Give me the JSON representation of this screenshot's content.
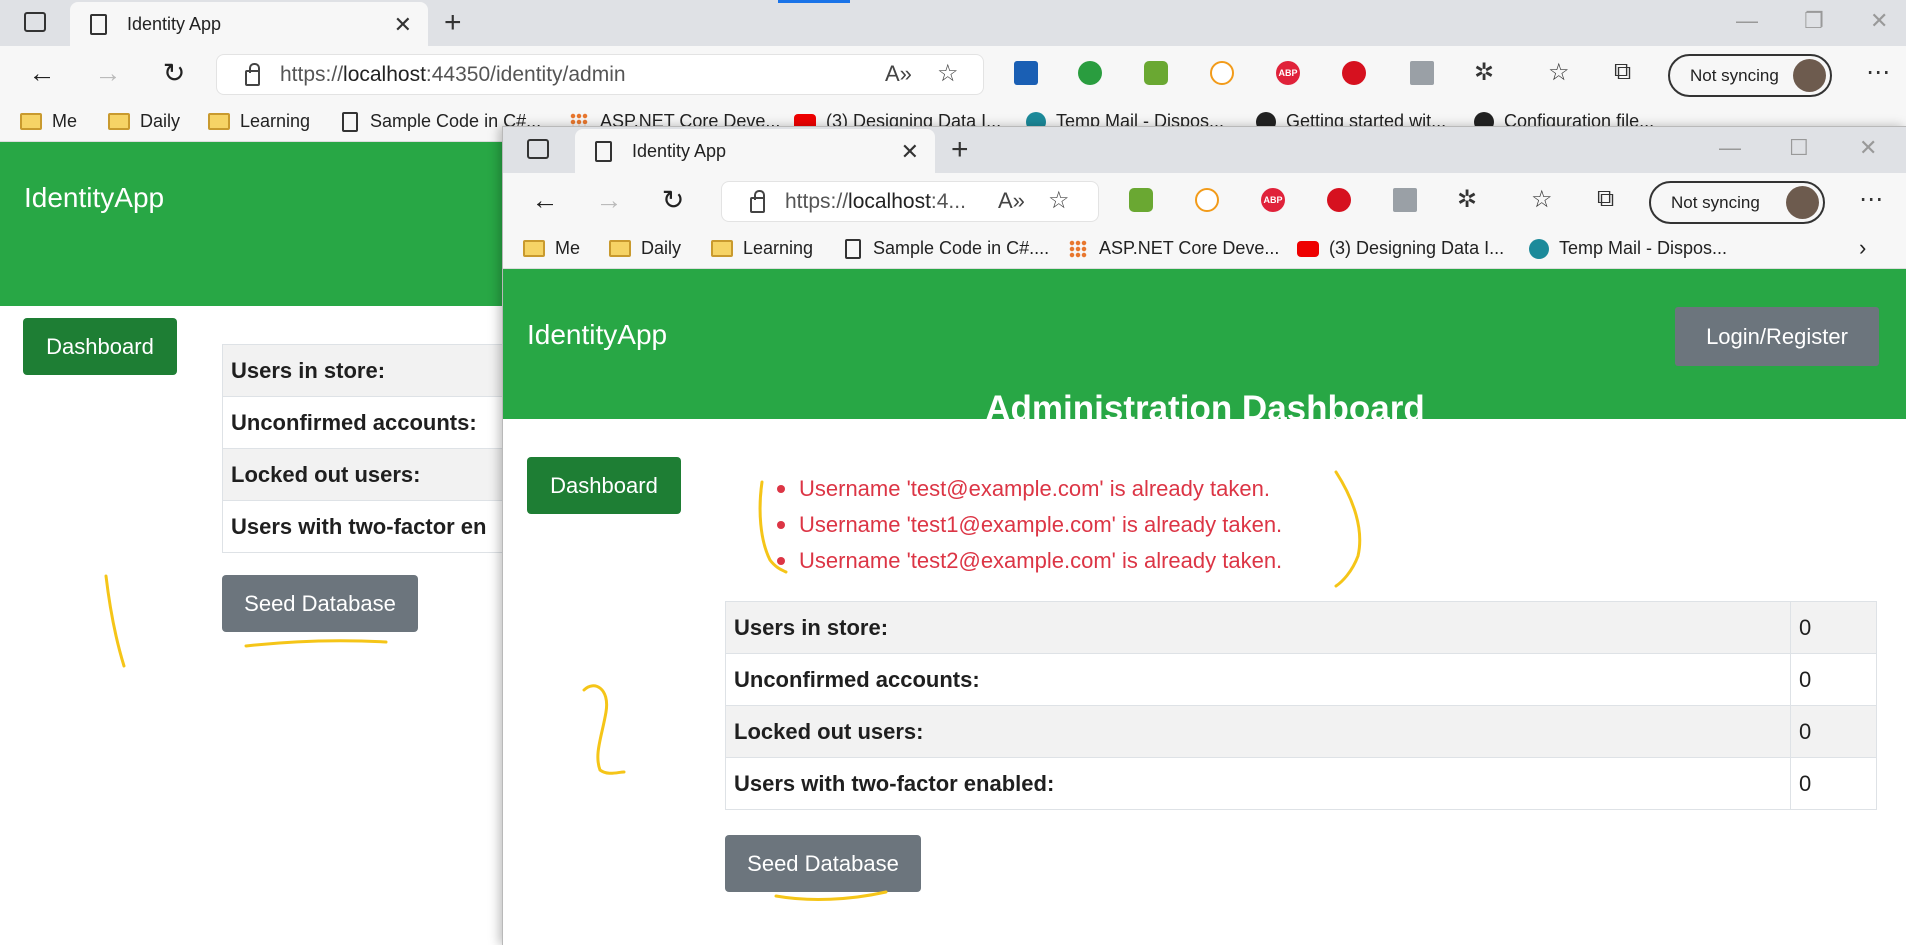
{
  "back_window": {
    "tab_title": "Identity App",
    "url_prefix": "https://",
    "url_host": "localhost",
    "url_rest": ":44350/identity/admin",
    "sync_label": "Not syncing",
    "bookmarks": [
      "Me",
      "Daily",
      "Learning",
      "Sample Code in C#...",
      "ASP.NET Core Deve...",
      "(3) Designing Data I...",
      "Temp Mail - Dispos...",
      "Getting started wit...",
      "Configuration file..."
    ],
    "brand": "IdentityApp",
    "dashboard_label": "Dashboard",
    "stats_labels": [
      "Users in store:",
      "Unconfirmed accounts:",
      "Locked out users:",
      "Users with two-factor en"
    ],
    "seed_label": "Seed Database"
  },
  "front_window": {
    "tab_title": "Identity App",
    "url_prefix": "https://",
    "url_host": "localhost",
    "url_rest": ":4...",
    "sync_label": "Not syncing",
    "bookmarks": [
      "Me",
      "Daily",
      "Learning",
      "Sample Code in C#....",
      "ASP.NET Core Deve...",
      "(3) Designing Data I...",
      "Temp Mail - Dispos..."
    ],
    "brand": "IdentityApp",
    "login_label": "Login/Register",
    "page_title": "Administration Dashboard",
    "dashboard_label": "Dashboard",
    "errors": [
      "Username 'test@example.com' is already taken.",
      "Username 'test1@example.com' is already taken.",
      "Username 'test2@example.com' is already taken."
    ],
    "stats": [
      {
        "label": "Users in store:",
        "value": "0"
      },
      {
        "label": "Unconfirmed accounts:",
        "value": "0"
      },
      {
        "label": "Locked out users:",
        "value": "0"
      },
      {
        "label": "Users with two-factor enabled:",
        "value": "0"
      }
    ],
    "seed_label": "Seed Database"
  },
  "annotations": {
    "num1": "1",
    "num2": "2",
    "color": "#f5c518"
  },
  "colors": {
    "header_green": "#28a745",
    "dashboard_btn": "#1e7e34",
    "secondary_btn": "#6c757d",
    "error_red": "#dc3545"
  }
}
